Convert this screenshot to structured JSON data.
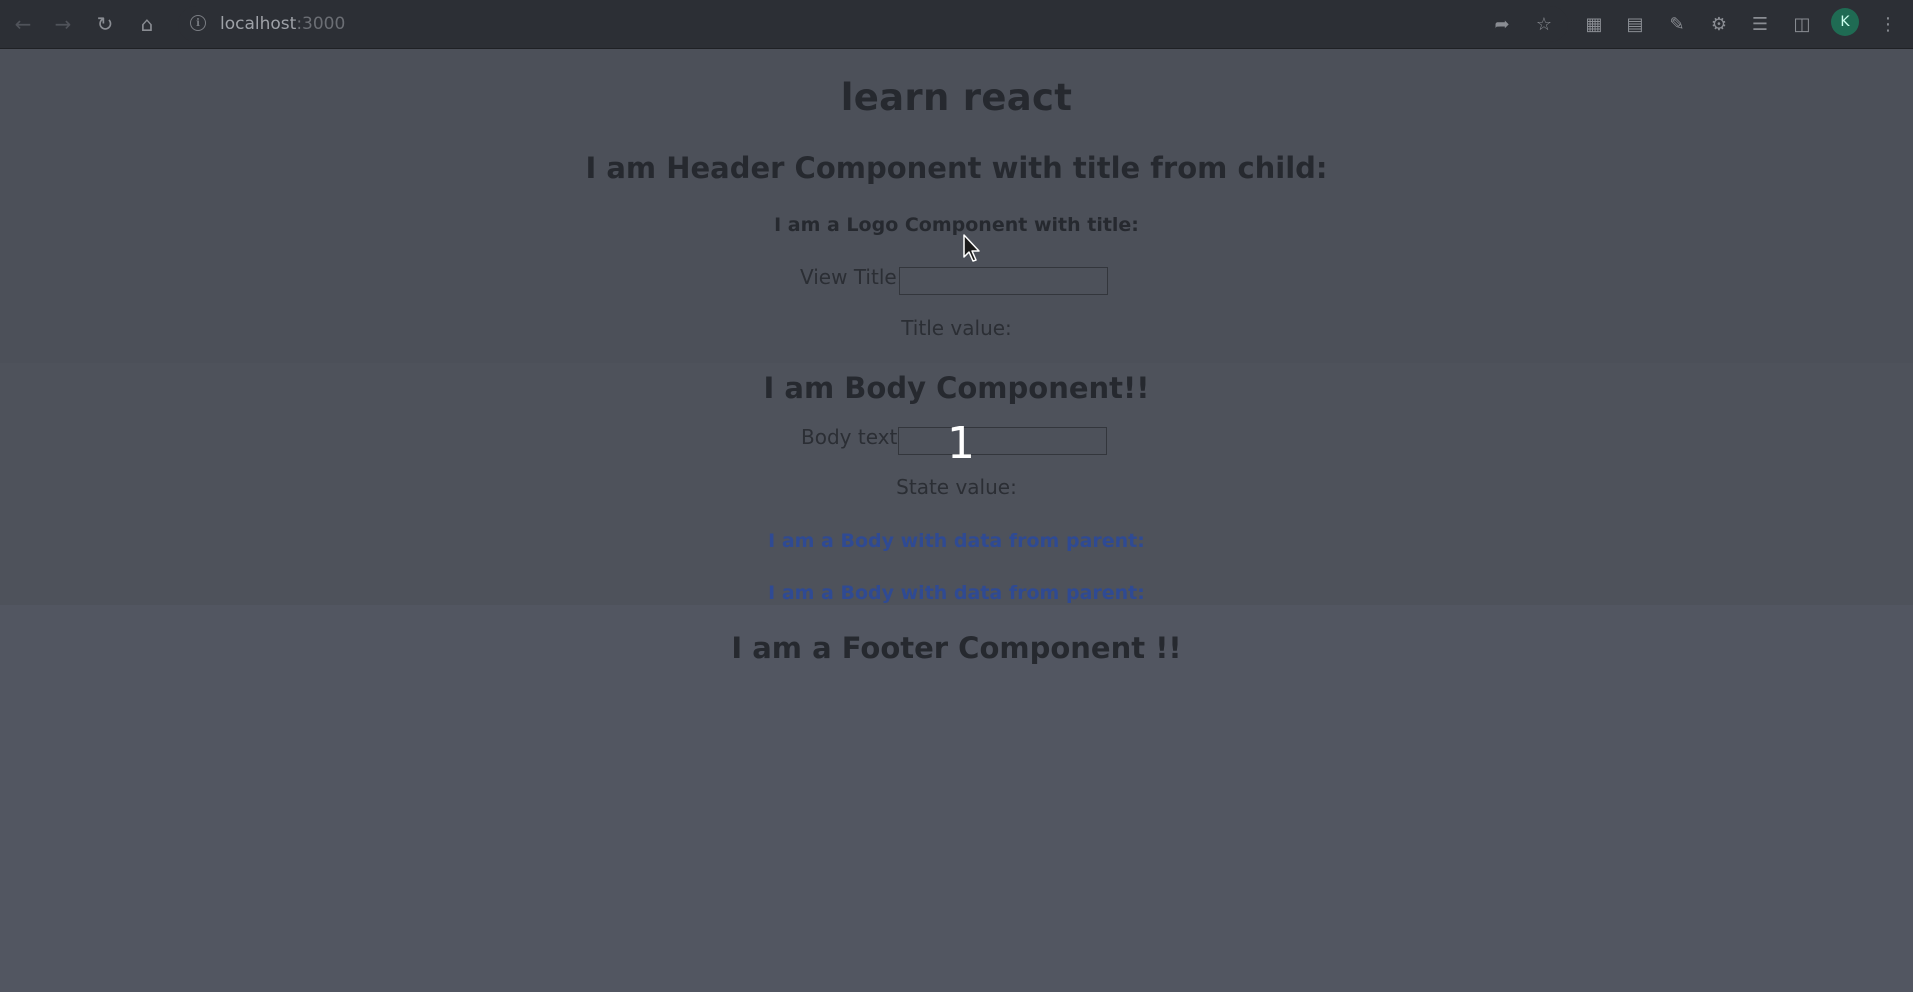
{
  "browser": {
    "url_host": "localhost",
    "url_port": ":3000",
    "avatar_initial": "K",
    "icons": [
      "back-icon",
      "forward-icon",
      "reload-icon",
      "home-icon",
      "info-icon",
      "share-icon",
      "bookmark-star-icon",
      "extension-icon",
      "extension-icon",
      "extension-icon",
      "puzzle-icon",
      "reading-list-icon",
      "side-panel-icon",
      "profile-avatar",
      "kebab-menu-icon"
    ]
  },
  "app": {
    "title": "learn react",
    "header_heading": "I am Header Component with title from child:",
    "logo_heading": "I am a Logo Component with title:",
    "view_title_label": "View Title:",
    "view_title_value": "",
    "title_value_label": "Title value:",
    "body_heading": "I am Body Component!!",
    "body_text_label": "Body text:",
    "body_text_value": "",
    "state_value_label": "State value:",
    "state_value": "1",
    "body_parent_1": "I am a Body with data from parent:",
    "body_parent_2": "I am a Body with data from parent:",
    "footer_heading": "I am a Footer Component !!"
  },
  "colors": {
    "page_bg": "#525661",
    "text": "#26292f",
    "link_blue": "#2f4a93"
  }
}
